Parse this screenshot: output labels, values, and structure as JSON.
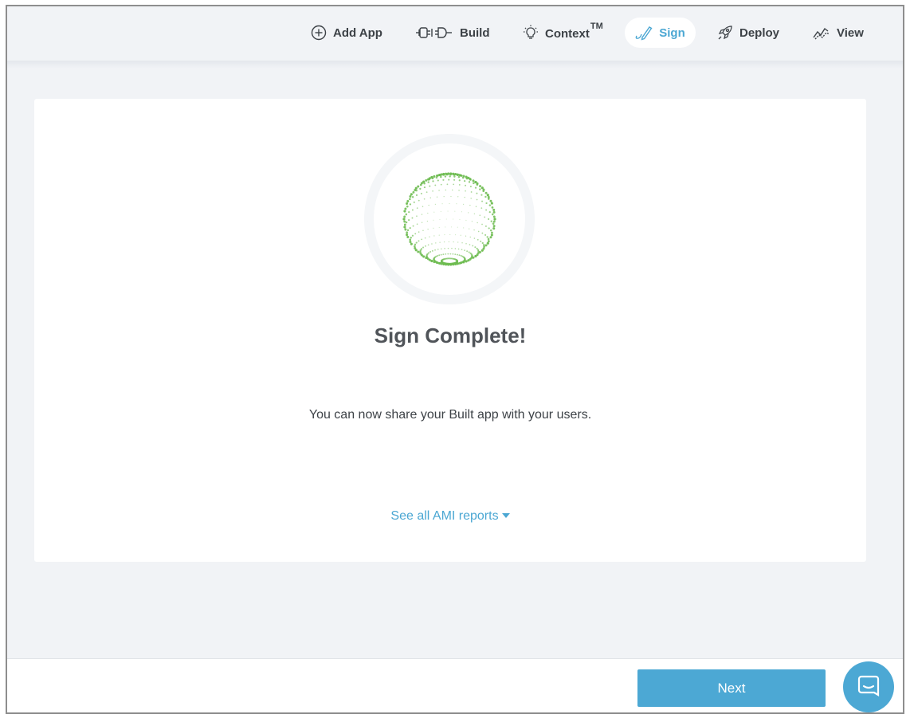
{
  "nav": {
    "items": [
      {
        "label": "Add App",
        "icon": "plus-circle-icon"
      },
      {
        "label": "Build",
        "icon": "plug-icon"
      },
      {
        "label": "Context",
        "sup": "TM",
        "icon": "lightbulb-icon"
      },
      {
        "label": "Sign",
        "icon": "signature-pen-icon",
        "active": true
      },
      {
        "label": "Deploy",
        "icon": "rocket-icon"
      },
      {
        "label": "View",
        "icon": "trend-line-icon"
      }
    ]
  },
  "main": {
    "title": "Sign Complete!",
    "subtitle": "You can now share your Built app with your users.",
    "reports_link": "See all AMI reports"
  },
  "footer": {
    "next_label": "Next"
  },
  "colors": {
    "accent": "#4ba7d3",
    "globe_green": "#6cbb4f",
    "background": "#f1f3f6"
  }
}
